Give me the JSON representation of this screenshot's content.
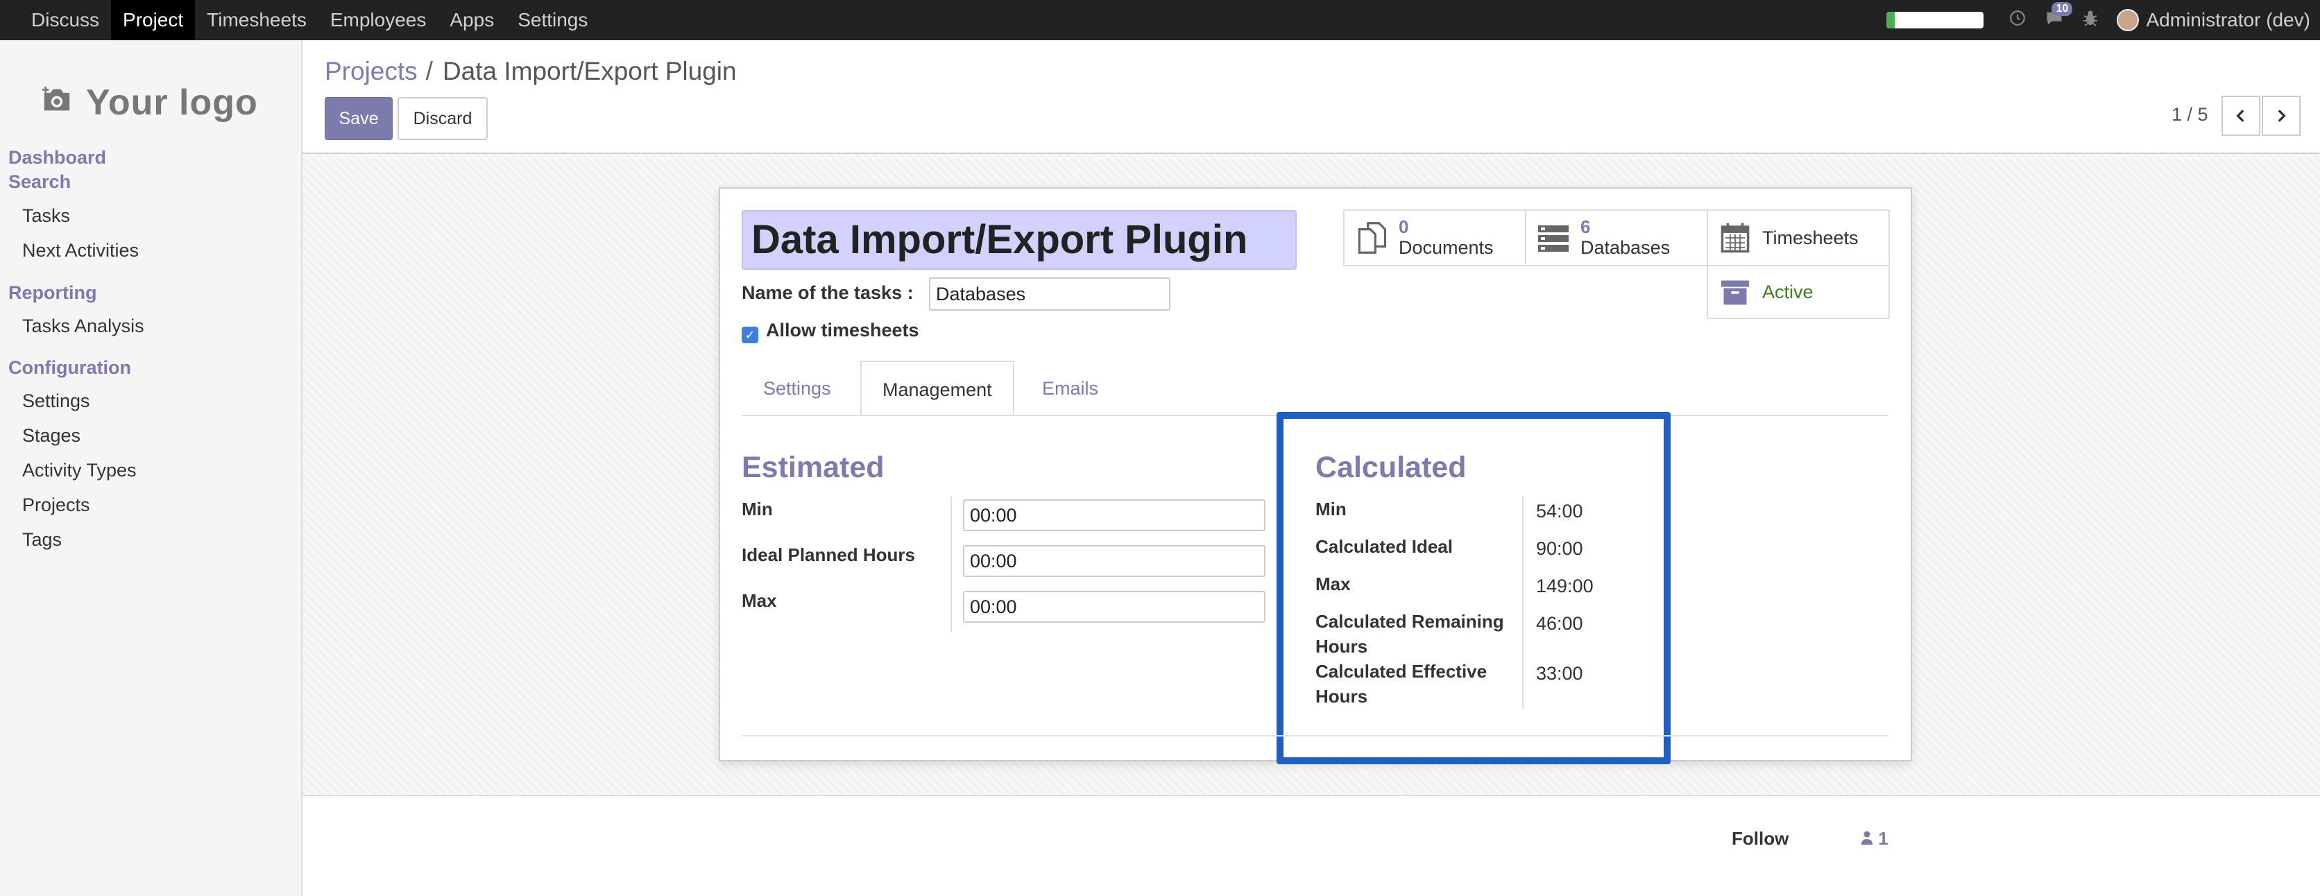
{
  "navbar": {
    "menu": [
      "Discuss",
      "Project",
      "Timesheets",
      "Employees",
      "Apps",
      "Settings"
    ],
    "active_index": 1,
    "progress_fraction": 0.08,
    "messages_count": "10",
    "user": "Administrator (dev)",
    "icons": [
      "clock-icon",
      "chat-icon",
      "bug-icon"
    ]
  },
  "sidebar": {
    "logo_text": "Your logo",
    "sections": [
      {
        "heading": "Dashboard",
        "items": []
      },
      {
        "heading": "Search",
        "items": [
          "Tasks",
          "Next Activities"
        ]
      },
      {
        "heading": "Reporting",
        "items": [
          "Tasks Analysis"
        ]
      },
      {
        "heading": "Configuration",
        "items": [
          "Settings",
          "Stages",
          "Activity Types",
          "Projects",
          "Tags"
        ]
      }
    ]
  },
  "control": {
    "breadcrumb_parent": "Projects",
    "breadcrumb_sep": "/",
    "breadcrumb_current": "Data Import/Export Plugin",
    "save_label": "Save",
    "discard_label": "Discard",
    "pager": "1 / 5"
  },
  "form": {
    "project_name": "Data Import/Export Plugin",
    "tasks_label": "Name of the tasks :",
    "tasks_value": "Databases",
    "allow_timesheets_label": "Allow timesheets",
    "allow_timesheets_checked": true
  },
  "stats": {
    "documents": {
      "value": "0",
      "label": "Documents"
    },
    "databases": {
      "value": "6",
      "label": "Databases"
    },
    "timesheets": {
      "label": "Timesheets"
    },
    "active": {
      "label": "Active"
    }
  },
  "tabs": [
    "Settings",
    "Management",
    "Emails"
  ],
  "active_tab": "Management",
  "estimated": {
    "title": "Estimated",
    "rows": [
      {
        "label": "Min",
        "value": "00:00"
      },
      {
        "label": "Ideal Planned Hours",
        "value": "00:00"
      },
      {
        "label": "Max",
        "value": "00:00"
      }
    ]
  },
  "calculated": {
    "title": "Calculated",
    "rows": [
      {
        "label": "Min",
        "value": "54:00"
      },
      {
        "label": "Calculated Ideal",
        "value": "90:00"
      },
      {
        "label": "Max",
        "value": "149:00"
      },
      {
        "label": "Calculated Remaining Hours",
        "value": "46:00"
      },
      {
        "label": "Calculated Effective Hours",
        "value": "33:00"
      }
    ]
  },
  "chatter": {
    "follow_label": "Follow",
    "followers_count": "1"
  },
  "colors": {
    "brand": "#7c7bad",
    "highlight_border": "#1f5fc1",
    "active_status": "#3f7f1f",
    "navbar": "#222222"
  }
}
